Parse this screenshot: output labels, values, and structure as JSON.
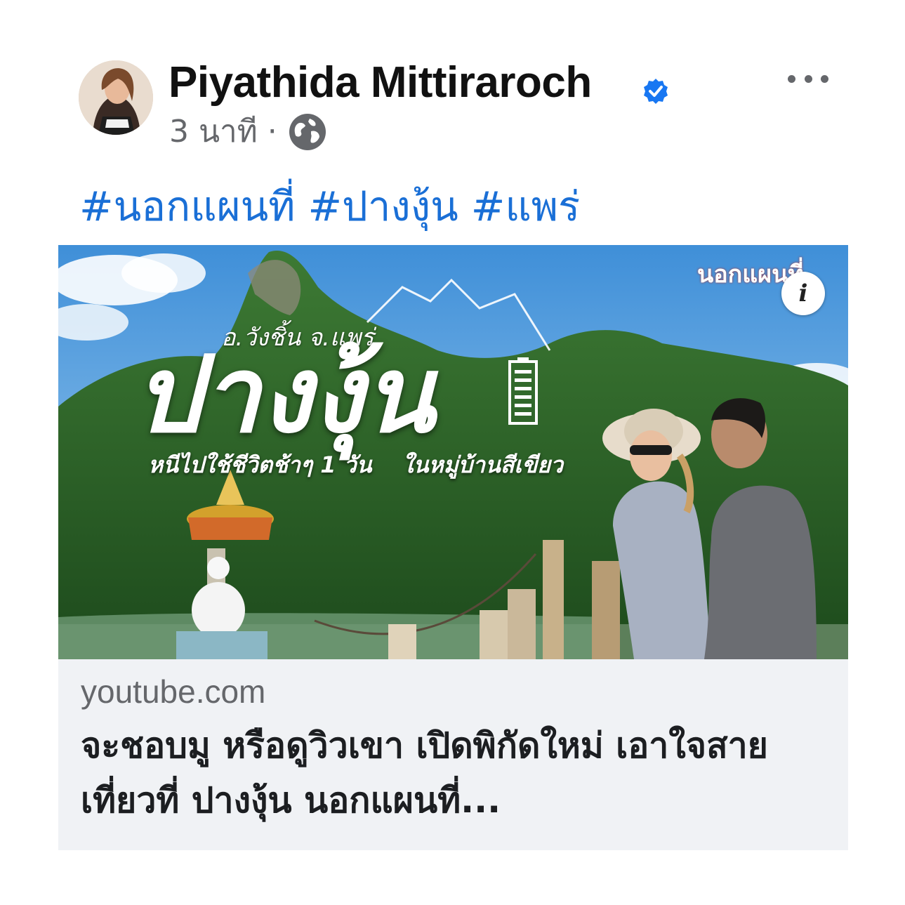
{
  "post": {
    "author_name": "Piyathida Mittiraroch",
    "timestamp": "3 นาที",
    "separator": "·",
    "privacy_icon": "globe-icon",
    "verified_icon": "verified-badge-icon",
    "more_icon": "more-options-icon",
    "hashtags": [
      "#นอกแผนที่",
      "#ปางงุ้น",
      "#แพร่"
    ]
  },
  "link_card": {
    "thumbnail": {
      "overlay_logo": "นอกแผนที่",
      "place_caption": "อ.วังชิ้น จ.แพร่",
      "big_title": "ปางงุ้น",
      "subtitle_left": "หนีไปใช้ชีวิตช้าๆ 1 วัน",
      "subtitle_right": "ในหมู่บ้านสีเขียว",
      "info_label": "i"
    },
    "domain": "youtube.com",
    "title": "จะชอบมู หรือดูวิวเขา เปิดพิกัดใหม่ เอาใจสายเที่ยวที่ ปางงุ้น นอกแผนที่..."
  },
  "colors": {
    "hashtag": "#1a6fd6",
    "verified": "#1877f2",
    "secondary_text": "#65676b",
    "caption_bg": "#f0f2f5"
  }
}
